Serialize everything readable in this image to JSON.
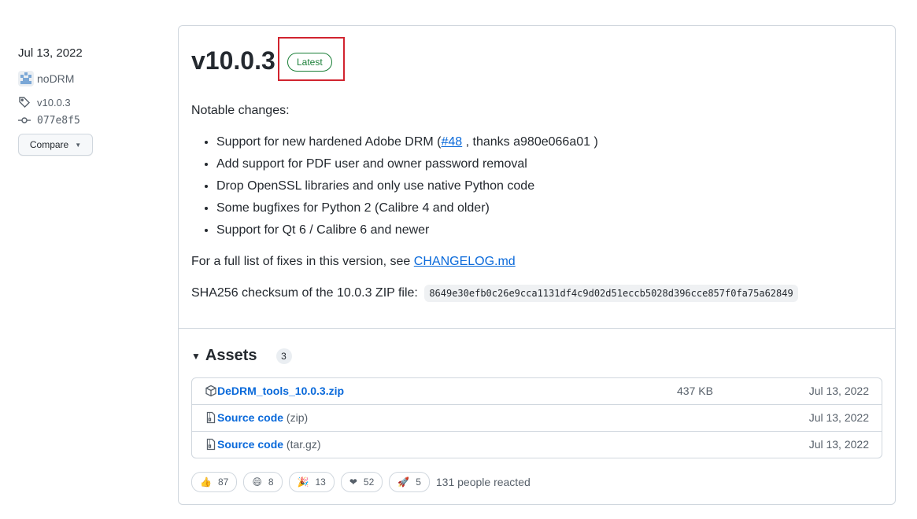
{
  "meta": {
    "date": "Jul 13, 2022",
    "author": "noDRM",
    "tag": "v10.0.3",
    "commit": "077e8f5",
    "compare_label": "Compare"
  },
  "release": {
    "title": "v10.0.3",
    "badge": "Latest",
    "notable": "Notable changes:",
    "changes": [
      {
        "pre": "Support for new hardened Adobe DRM (",
        "link": "#48",
        "post": " , thanks a980e066a01 )"
      },
      {
        "text": "Add support for PDF user and owner password removal"
      },
      {
        "text": "Drop OpenSSL libraries and only use native Python code"
      },
      {
        "text": "Some bugfixes for Python 2 (Calibre 4 and older)"
      },
      {
        "text": "Support for Qt 6 / Calibre 6 and newer"
      }
    ],
    "fixes_pre": "For a full list of fixes in this version, see ",
    "fixes_link": "CHANGELOG.md",
    "sha_label": "SHA256 checksum of the 10.0.3 ZIP file:",
    "sha_value": "8649e30efb0c26e9cca1131df4c9d02d51eccb5028d396cce857f0fa75a62849"
  },
  "assets": {
    "title": "Assets",
    "count": "3",
    "items": [
      {
        "name": "DeDRM_tools_10.0.3.zip",
        "ext": "",
        "size": "437 KB",
        "date": "Jul 13, 2022",
        "icon": "package-icon"
      },
      {
        "name": "Source code",
        "ext": "(zip)",
        "size": "",
        "date": "Jul 13, 2022",
        "icon": "file-zip-icon"
      },
      {
        "name": "Source code",
        "ext": "(tar.gz)",
        "size": "",
        "date": "Jul 13, 2022",
        "icon": "file-zip-icon"
      }
    ]
  },
  "reactions": {
    "items": [
      {
        "emoji": "👍",
        "count": "87",
        "name": "thumbs-up"
      },
      {
        "emoji": "😄",
        "count": "8",
        "name": "laugh"
      },
      {
        "emoji": "🎉",
        "count": "13",
        "name": "hooray"
      },
      {
        "emoji": "❤",
        "count": "52",
        "name": "heart"
      },
      {
        "emoji": "🚀",
        "count": "5",
        "name": "rocket"
      }
    ],
    "summary": "131 people reacted"
  },
  "colors": {
    "link": "#0969da",
    "latest_badge": "#1a7f37",
    "highlight_box": "#d1242f"
  }
}
